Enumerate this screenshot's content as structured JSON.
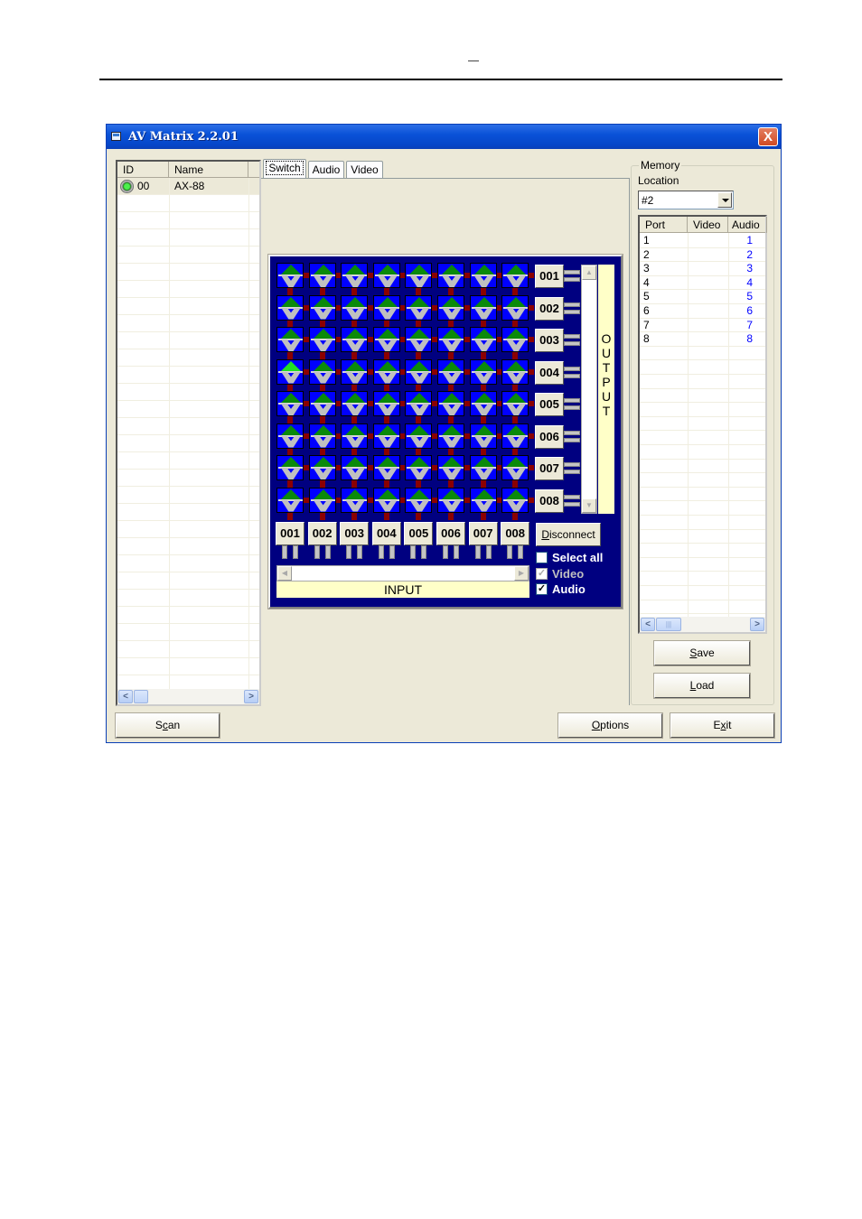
{
  "page": {
    "header_mark": "—"
  },
  "window": {
    "title": "AV Matrix 2.2.01",
    "close_label": "X"
  },
  "device_list": {
    "columns": [
      "ID",
      "Name"
    ],
    "rows": [
      {
        "id": "00",
        "name": "AX-88",
        "status": "online",
        "selected": true
      }
    ]
  },
  "tabs": [
    {
      "label": "Switch",
      "active": true
    },
    {
      "label": "Audio",
      "active": false
    },
    {
      "label": "Video",
      "active": false
    }
  ],
  "matrix": {
    "outputs": [
      "001",
      "002",
      "003",
      "004",
      "005",
      "006",
      "007",
      "008"
    ],
    "inputs": [
      "001",
      "002",
      "003",
      "004",
      "005",
      "006",
      "007",
      "008"
    ],
    "output_label": [
      "O",
      "U",
      "T",
      "P",
      "U",
      "T"
    ],
    "input_label": "INPUT",
    "highlighted": [
      {
        "output": 4,
        "input": 1
      }
    ],
    "disconnect_label": "Disconnect",
    "checkboxes": [
      {
        "label": "Select all",
        "checked": false,
        "enabled": true
      },
      {
        "label": "Video",
        "checked": true,
        "enabled": false
      },
      {
        "label": "Audio",
        "checked": true,
        "enabled": true
      }
    ]
  },
  "memory": {
    "group_label": "Memory",
    "location_label": "Location",
    "location_value": "#2",
    "columns": [
      "Port",
      "Video",
      "Audio"
    ],
    "rows": [
      {
        "port": "1",
        "video": "",
        "audio": "1"
      },
      {
        "port": "2",
        "video": "",
        "audio": "2"
      },
      {
        "port": "3",
        "video": "",
        "audio": "3"
      },
      {
        "port": "4",
        "video": "",
        "audio": "4"
      },
      {
        "port": "5",
        "video": "",
        "audio": "5"
      },
      {
        "port": "6",
        "video": "",
        "audio": "6"
      },
      {
        "port": "7",
        "video": "",
        "audio": "7"
      },
      {
        "port": "8",
        "video": "",
        "audio": "8"
      }
    ],
    "save_label": "Save",
    "load_label": "Load"
  },
  "footer": {
    "scan_label": "Scan",
    "options_label": "Options",
    "exit_label": "Exit"
  },
  "colors": {
    "matrix_bg": "#000080",
    "cell_bg": "#0000ff",
    "link": "#8b0000",
    "green_off": "#0a8a0a",
    "green_on": "#22e022",
    "label_bg": "#ffffc8",
    "audio_text": "#0000ff"
  }
}
